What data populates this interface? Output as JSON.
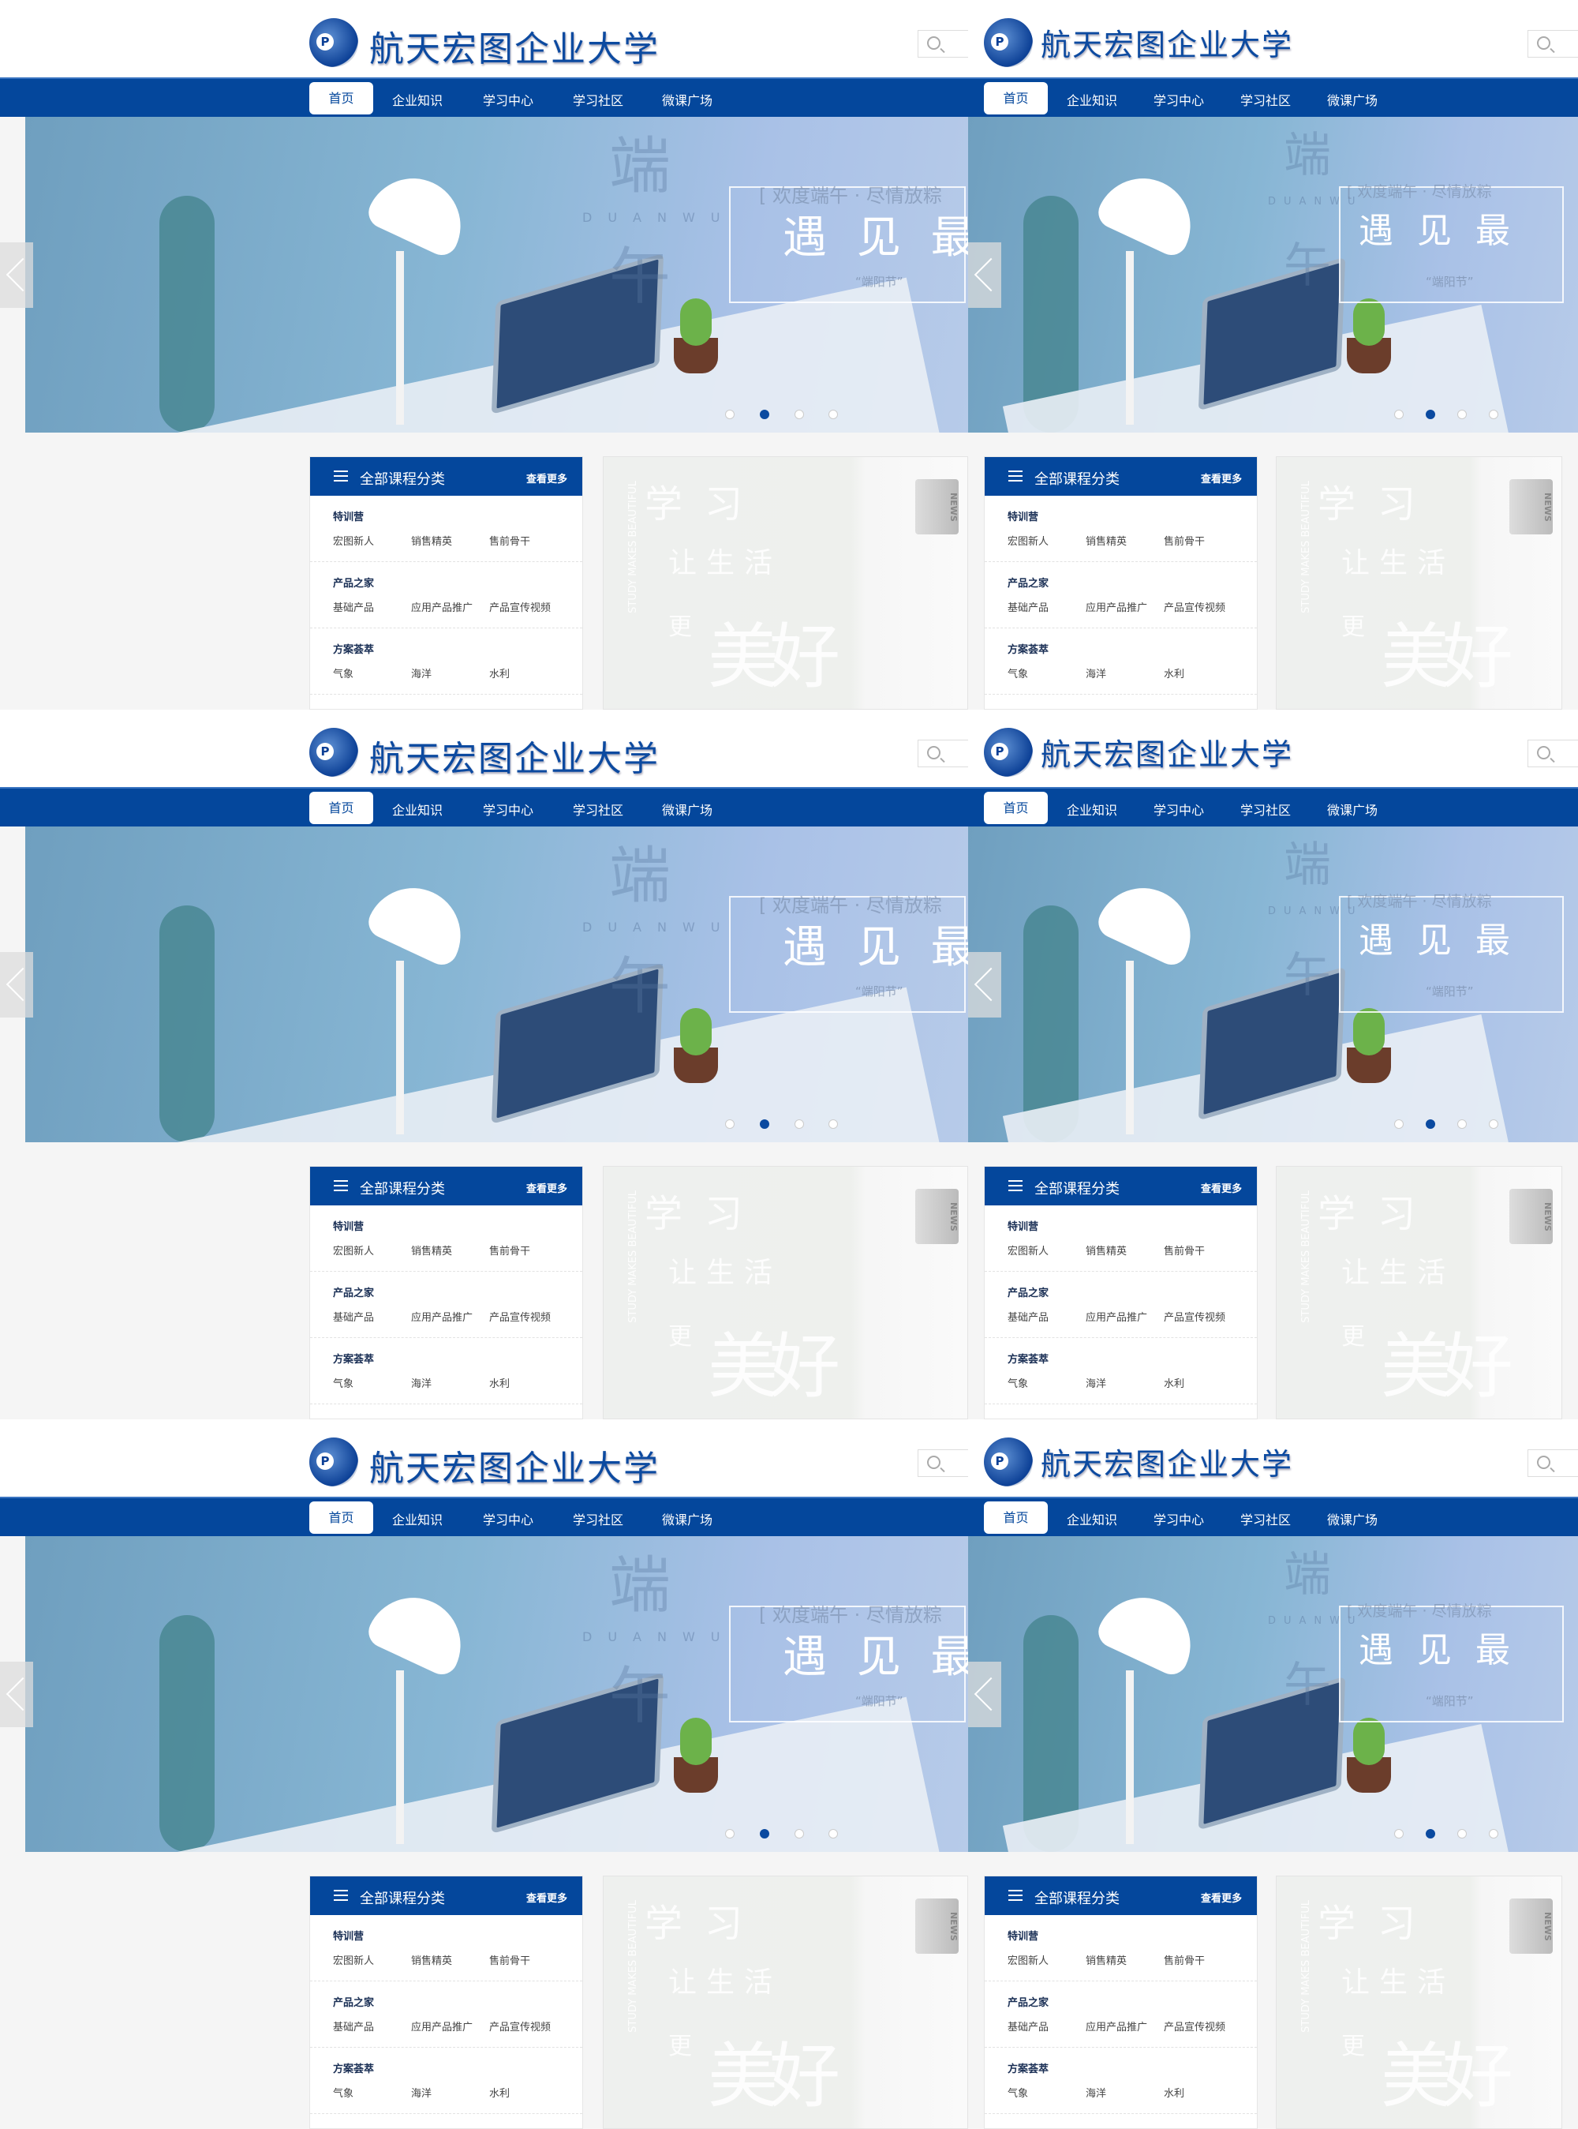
{
  "header": {
    "logo_letter": "P",
    "site_title": "航天宏图企业大学"
  },
  "nav": {
    "items": [
      "首页",
      "企业知识",
      "学习中心",
      "学习社区",
      "微课广场"
    ]
  },
  "banner": {
    "char_top": "端",
    "pinyin": "DUANWU",
    "char_bottom": "午",
    "subtitle": "[ 欢度端午 · 尽情放粽",
    "headline": "遇 见 最",
    "festival": "“端阳节”",
    "active_slide": 2,
    "slide_count": 4
  },
  "categories": {
    "title": "全部课程分类",
    "more": "查看更多",
    "groups": [
      {
        "name": "特训营",
        "items": [
          "宏图新人",
          "销售精英",
          "售前骨干"
        ]
      },
      {
        "name": "产品之家",
        "items": [
          "基础产品",
          "应用产品推广",
          "产品宣传视频"
        ]
      },
      {
        "name": "方案荟萃",
        "items": [
          "气象",
          "海洋",
          "水利"
        ]
      }
    ]
  },
  "promo": {
    "chars": [
      "学",
      "习",
      "让",
      "生",
      "活",
      "更",
      "美",
      "好"
    ],
    "english": "STUDY MAKES BEAUTIFUL",
    "badge": "NEWS"
  },
  "colors": {
    "primary": "#04479c",
    "background": "#f5f5f5"
  }
}
